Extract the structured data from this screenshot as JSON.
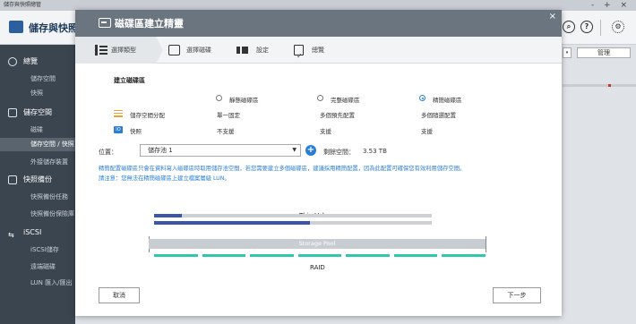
{
  "app": {
    "window_title": "儲存與快照總管",
    "title": "儲存與快照",
    "manage_label": "管理",
    "window_controls": "- + ×"
  },
  "sidebar": {
    "groups": [
      {
        "label": "總覽",
        "icon": "dashboard-icon",
        "items": [
          "儲存空間",
          "快照"
        ]
      },
      {
        "label": "儲存空間",
        "icon": "storage-icon",
        "items": [
          "磁碟",
          "儲存空間 / 快照",
          "外接儲存裝置"
        ]
      },
      {
        "label": "快照備份",
        "icon": "snapshot-backup-icon",
        "items": [
          "快照備份任務",
          "快照備份保險庫"
        ]
      },
      {
        "label": "iSCSI",
        "icon": "iscsi-icon",
        "items": [
          "iSCSI儲存",
          "遠端磁碟",
          "LUN 匯入/匯出"
        ]
      }
    ]
  },
  "modal": {
    "title": "磁碟區建立精靈",
    "close": "×",
    "steps": [
      {
        "label": "選擇類型",
        "icon": "list-icon"
      },
      {
        "label": "選擇磁碟",
        "icon": "disk-icon"
      },
      {
        "label": "設定",
        "icon": "settings-icon"
      },
      {
        "label": "總覽",
        "icon": "checklist-icon"
      }
    ],
    "section_title": "建立磁碟區",
    "options": [
      {
        "label": "靜態磁碟區",
        "selected": false
      },
      {
        "label": "完整磁碟區",
        "selected": false
      },
      {
        "label": "精簡磁碟區",
        "selected": true
      }
    ],
    "rows": [
      {
        "label": "儲存空間分配",
        "icon": "allocation-icon",
        "values": [
          "單一固定",
          "多個預先配置",
          "多個隨選配置"
        ]
      },
      {
        "label": "快照",
        "icon": "snapshot-icon",
        "values": [
          "不支援",
          "支援",
          "支援"
        ]
      }
    ],
    "location_label": "位置：",
    "location_value": "儲存池 1",
    "free_label": "剩餘空間：",
    "free_value": "3.53 TB",
    "notice": "精簡配置磁碟區只會在資料寫入磁碟區時取用儲存池空間，若您需要建立多個磁碟區，建議採用精簡配置，因為此配置可確保您有效利用儲存空間。請注意：您無法在精簡磁碟區上建立檔案層級 LUN。",
    "diagram": {
      "thin_label": "Thin Volume",
      "pool_label": "Storage Pool",
      "raid_label": "RAID",
      "bar1_fill": 0.1,
      "bar2_fill": 0.56
    },
    "cancel_label": "取消",
    "next_label": "下一步"
  }
}
